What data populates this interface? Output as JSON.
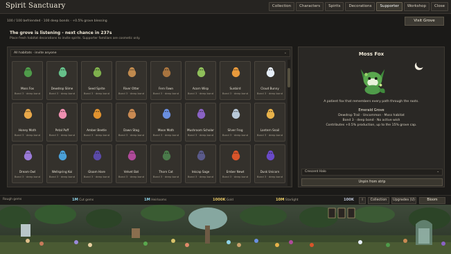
{
  "app": {
    "title": "Spirit Sanctuary",
    "tabs": [
      "Collection",
      "Characters",
      "Spirits",
      "Decorations",
      "Supporter",
      "Workshop",
      "Close"
    ],
    "active_tab": "Supporter"
  },
  "status_line": "100 / 100 befriended  ·  100 deep bonds  ·  +0.5% grove blessing",
  "visit_button": "Visit Grove",
  "notice": {
    "title": "The grove is listening - next chance in 237s",
    "subtitle": "Place fresh habitat decorations to invite spirits. Supporter familiars are cosmetic only."
  },
  "filter": {
    "label": "All habitats  ·  invite anyone",
    "icon": "chevron-down-icon"
  },
  "spirits": [
    {
      "name": "Moss Fox",
      "bond": "Bond 3 · deep bond",
      "icon": "fox-icon",
      "color": "#4f9b4a"
    },
    {
      "name": "Dewdrop Slime",
      "bond": "Bond 3 · deep bond",
      "icon": "slime-icon",
      "color": "#66c08a"
    },
    {
      "name": "Seed Sprite",
      "bond": "Bond 3 · deep bond",
      "icon": "sprout-icon",
      "color": "#7fb04d"
    },
    {
      "name": "River Otter",
      "bond": "Bond 3 · deep bond",
      "icon": "otter-icon",
      "color": "#c08a4e"
    },
    {
      "name": "Fern Fawn",
      "bond": "Bond 3 · deep bond",
      "icon": "fawn-icon",
      "color": "#a8743f"
    },
    {
      "name": "Acorn Wisp",
      "bond": "Bond 3 · deep bond",
      "icon": "acorn-icon",
      "color": "#8fbf5a"
    },
    {
      "name": "Sunbird",
      "bond": "Bond 3 · deep bond",
      "icon": "bird-icon",
      "color": "#e89a3c"
    },
    {
      "name": "Cloud Bunny",
      "bond": "Bond 3 · deep bond",
      "icon": "bunny-icon",
      "color": "#e6eef8"
    },
    {
      "name": "Honey Moth",
      "bond": "Bond 3 · deep bond",
      "icon": "moth-icon",
      "color": "#e8a84a"
    },
    {
      "name": "Petal Puff",
      "bond": "Bond 3 · deep bond",
      "icon": "flower-icon",
      "color": "#ee8fb0"
    },
    {
      "name": "Amber Beetle",
      "bond": "Bond 3 · deep bond",
      "icon": "beetle-icon",
      "color": "#e0922f"
    },
    {
      "name": "Dawn Stag",
      "bond": "Bond 3 · deep bond",
      "icon": "stag-icon",
      "color": "#c98a52"
    },
    {
      "name": "Moon Moth",
      "bond": "Bond 3 · deep bond",
      "icon": "moth-icon",
      "color": "#6a8fe0"
    },
    {
      "name": "Mushroom Scholar",
      "bond": "Bond 3 · deep bond",
      "icon": "mushroom-icon",
      "color": "#8a62c4"
    },
    {
      "name": "Silver Frog",
      "bond": "Bond 3 · deep bond",
      "icon": "frog-icon",
      "color": "#b8c8d8"
    },
    {
      "name": "Lantern Snail",
      "bond": "Bond 3 · deep bond",
      "icon": "snail-icon",
      "color": "#e8b24a"
    },
    {
      "name": "Dream Owl",
      "bond": "Bond 3 · deep bond",
      "icon": "owl-icon",
      "color": "#9a7ad8"
    },
    {
      "name": "Wellspring Koi",
      "bond": "Bond 3 · deep bond",
      "icon": "koi-icon",
      "color": "#4aa0d8"
    },
    {
      "name": "Gloam Hare",
      "bond": "Bond 3 · deep bond",
      "icon": "hare-icon",
      "color": "#5a4aa8"
    },
    {
      "name": "Velvet Bat",
      "bond": "Bond 3 · deep bond",
      "icon": "bat-icon",
      "color": "#b04a9a"
    },
    {
      "name": "Thorn Cat",
      "bond": "Bond 3 · deep bond",
      "icon": "cat-icon",
      "color": "#4a7a4a"
    },
    {
      "name": "Inkcap Sage",
      "bond": "Bond 3 · deep bond",
      "icon": "wizard-icon",
      "color": "#5a5a8a"
    },
    {
      "name": "Ember Newt",
      "bond": "Bond 3 · deep bond",
      "icon": "newt-icon",
      "color": "#d8542a"
    },
    {
      "name": "Dusk Unicorn",
      "bond": "Bond 3 · deep bond",
      "icon": "unicorn-icon",
      "color": "#6a4ac8"
    }
  ],
  "detail": {
    "title": "Moss Fox",
    "description": "A patient fox that remembers every path through the roots.",
    "lines": [
      "Emerald Grove",
      "Dewdrop Trail · Uncommon · Moss habitat",
      "Bond 3 · deep bond · No active wish",
      "Contributes +0.5% production, up to the 15% grove cap."
    ],
    "halo": "Crescent Halo",
    "unpin": "Unpin from strip",
    "moon_icon": "moon-icon"
  },
  "resources": [
    {
      "label": "Rough gems",
      "value": "1M",
      "label2": "Cut gems"
    },
    {
      "label": "",
      "value": "1M",
      "label2": "Heirlooms"
    },
    {
      "label": "",
      "value": "1000K",
      "label2": "Gold"
    },
    {
      "label": "",
      "value": "10M",
      "label2": "Starlight"
    },
    {
      "label": "",
      "value": "100K",
      "label2": ""
    }
  ],
  "res_buttons": {
    "info": "i",
    "collection": "Collection",
    "upgrades": "Upgrades (U)",
    "bloom": "Bloom"
  },
  "colors": {
    "background": "#1b1a18",
    "panel": "#2a2825",
    "card": "#34312c",
    "accent_cyan": "#8fd4e8",
    "accent_gold": "#e8c866"
  }
}
